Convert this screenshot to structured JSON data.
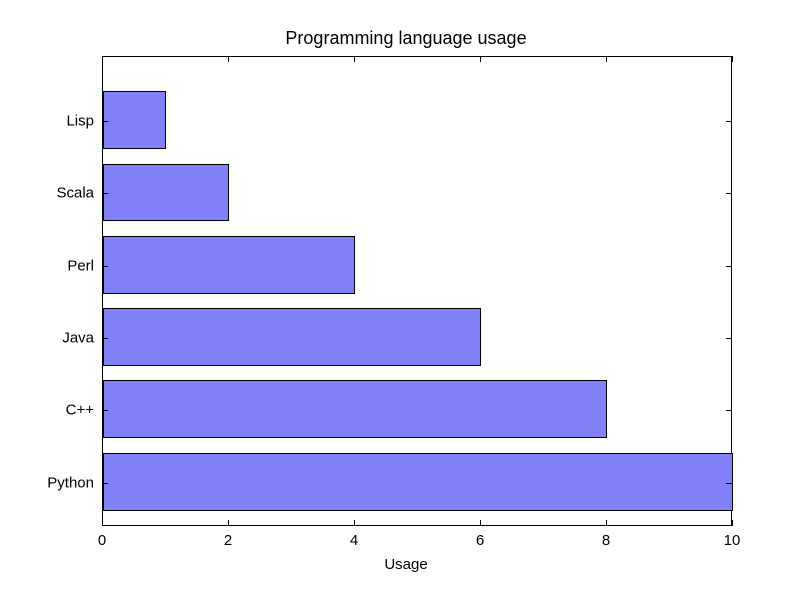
{
  "chart_data": {
    "type": "bar",
    "orientation": "horizontal",
    "categories": [
      "Python",
      "C++",
      "Java",
      "Perl",
      "Scala",
      "Lisp"
    ],
    "values": [
      10,
      8,
      6,
      4,
      2,
      1
    ],
    "title": "Programming language usage",
    "xlabel": "Usage",
    "ylabel": "",
    "xlim": [
      0,
      10
    ],
    "xticks": [
      0,
      2,
      4,
      6,
      8,
      10
    ],
    "bar_color": "#8080f7"
  }
}
